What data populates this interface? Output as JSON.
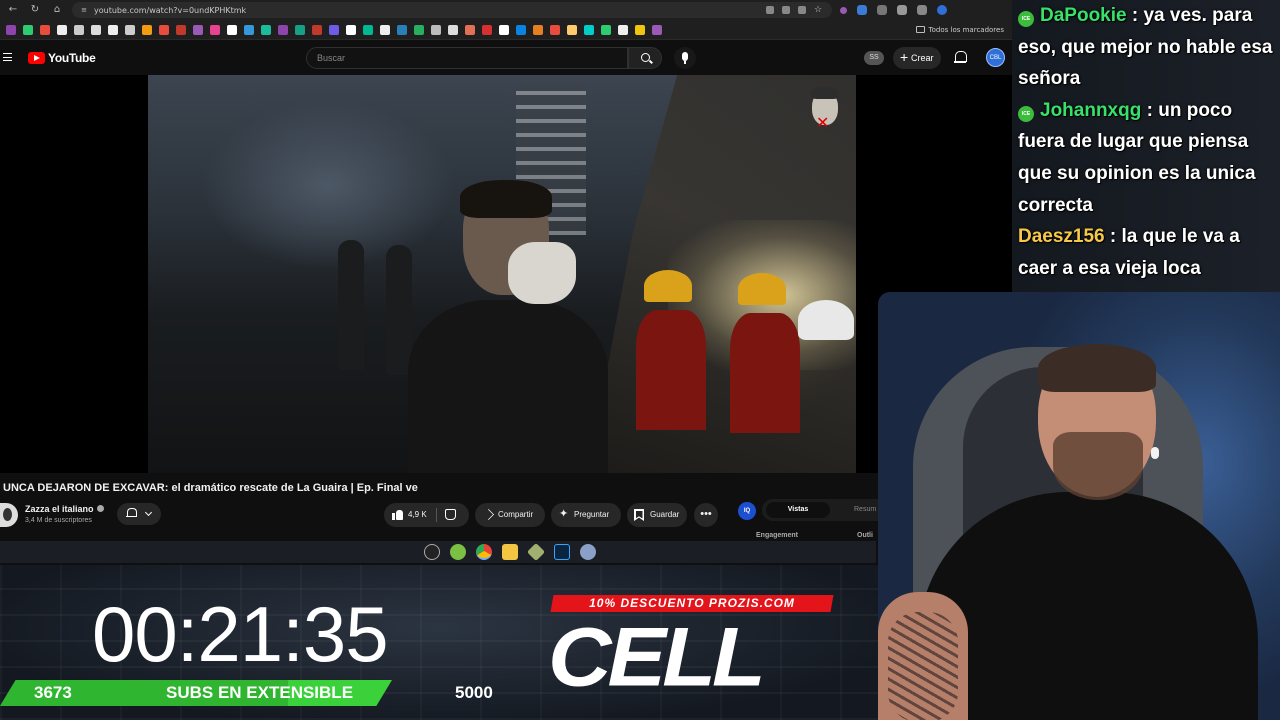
{
  "browser": {
    "url": "youtube.com/watch?v=0undKPHKtmk",
    "all_bookmarks": "Todos los marcadores"
  },
  "youtube": {
    "logo_text": "YouTube",
    "search_placeholder": "Buscar",
    "profile_badge": "SS",
    "create_label": "Crear",
    "avatar_text": "CBL",
    "video_title": "UNCA DEJARON DE EXCAVAR: el dramático rescate de La Guaira | Ep. Final ve",
    "channel_name": "Zazza el italiano",
    "subscribers": "3,4 M de suscriptores",
    "like_count": "4,9 K",
    "share_label": "Compartir",
    "ask_label": "Preguntar",
    "save_label": "Guardar",
    "more_label": "•••"
  },
  "side_panel": {
    "icon_text": "IQ",
    "tab_active": "Vistas",
    "tab_other": "Resum",
    "label_engagement": "Engagement",
    "label_outlier": "Outli"
  },
  "chat": {
    "messages": [
      {
        "user": "DaPookie",
        "text": ": ya ves. para eso, que mejor no hable esa señora",
        "badge": true,
        "color": "#39e06a"
      },
      {
        "user": "Johannxqg",
        "text": ": un poco fuera de lugar que piensa que su opinion es la unica correcta",
        "badge": true,
        "color": "#39e06a"
      },
      {
        "user": "Daesz156",
        "text": ": la que le va a caer a esa vieja loca",
        "badge": false,
        "color": "#f7c948"
      }
    ],
    "badge_text": "ICE"
  },
  "overlay": {
    "timer": "00:21:35",
    "subs_current": "3673",
    "subs_label": "SUBS EN EXTENSIBLE",
    "subs_goal": "5000",
    "subs_progress": 0.7346,
    "promo": "10% DESCUENTO PROZIS.COM",
    "sponsor": "CELL"
  },
  "colors": {
    "youtube_red": "#ff0000",
    "subs_green": "#3bd13b",
    "promo_red": "#e3141a",
    "chat_green": "#39e06a",
    "chat_yellow": "#f7c948"
  }
}
